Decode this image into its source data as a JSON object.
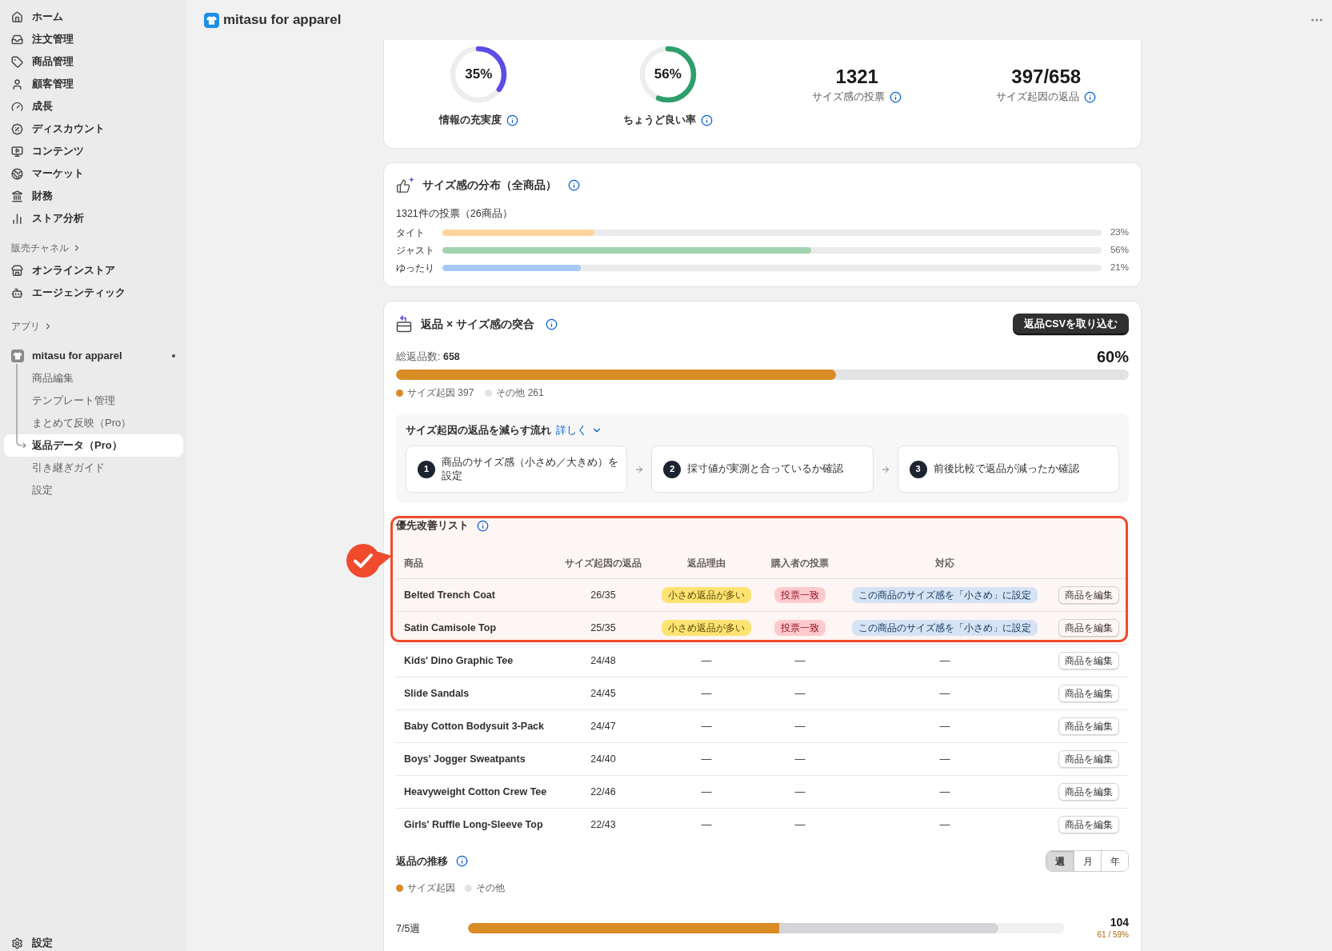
{
  "header": {
    "title": "mitasu for apparel"
  },
  "sidebar": {
    "nav": [
      {
        "label": "ホーム",
        "selected": false
      },
      {
        "label": "注文管理",
        "selected": false
      },
      {
        "label": "商品管理",
        "selected": false
      },
      {
        "label": "顧客管理",
        "selected": false
      },
      {
        "label": "成長",
        "selected": false
      },
      {
        "label": "ディスカウント",
        "selected": false
      },
      {
        "label": "コンテンツ",
        "selected": false
      },
      {
        "label": "マーケット",
        "selected": false
      },
      {
        "label": "財務",
        "selected": false
      },
      {
        "label": "ストア分析",
        "selected": false
      }
    ],
    "sales_channels": {
      "title": "販売チャネル",
      "items": [
        {
          "label": "オンラインストア",
          "selected": false
        },
        {
          "label": "エージェンティック",
          "selected": false
        }
      ]
    },
    "apps": {
      "title": "アプリ",
      "app": {
        "name": "mitasu for apparel",
        "children": [
          {
            "label": "商品編集",
            "selected": false
          },
          {
            "label": "テンプレート管理",
            "selected": false
          },
          {
            "label": "まとめて反映（Pro）",
            "selected": false
          },
          {
            "label": "返品データ（Pro）",
            "selected": true
          },
          {
            "label": "引き継ぎガイド",
            "selected": false
          },
          {
            "label": "設定",
            "selected": false
          }
        ]
      }
    },
    "footer": {
      "label": "設定"
    }
  },
  "stats": [
    {
      "kind": "ring",
      "value": "35%",
      "label": "情報の充実度",
      "level": 0.35,
      "color": "#5b4de6"
    },
    {
      "kind": "ring",
      "value": "56%",
      "label": "ちょうど良い率",
      "level": 0.56,
      "color": "#2e9e6b"
    },
    {
      "kind": "number",
      "value": "1321",
      "label": "サイズ感の投票"
    },
    {
      "kind": "number",
      "value": "397/658",
      "label": "サイズ起因の返品"
    }
  ],
  "distribution": {
    "title": "サイズ感の分布（全商品）",
    "summary": "1321件の投票（26商品）",
    "bars": [
      {
        "label": "タイト",
        "level": 0.23,
        "reading": "23%",
        "color": "#fcd49b"
      },
      {
        "label": "ジャスト",
        "level": 0.56,
        "reading": "56%",
        "color": "#a3d4b2"
      },
      {
        "label": "ゆったり",
        "level": 0.21,
        "reading": "21%",
        "color": "#a5c8f7"
      }
    ]
  },
  "returns": {
    "title": "返品 × サイズ感の突合",
    "import_button": "返品CSVを取り込む",
    "total": "総返品数: **658**",
    "share": "60%",
    "level": 0.6,
    "legend": [
      {
        "label": "サイズ起因 397",
        "color": "#d98b24"
      },
      {
        "label": "その他 261",
        "color": "#e3e3e3"
      }
    ],
    "flow": {
      "title": "サイズ起因の返品を減らす流れ",
      "link": "詳しく",
      "steps": [
        {
          "number": "1",
          "text": "商品のサイズ感（小さめ／大きめ）を設定"
        },
        {
          "number": "2",
          "text": "採寸値が実測と合っているか確認"
        },
        {
          "number": "3",
          "text": "前後比較で返品が減ったか確認"
        }
      ]
    },
    "priority_list": {
      "title": "優先改善リスト",
      "columns": [
        "商品",
        "サイズ起因の返品",
        "返品理由",
        "購入者の投票",
        "対応"
      ],
      "rows": [
        {
          "product": "Belted Trench Coat",
          "returns": "26/35",
          "reason": {
            "kind": "badge",
            "text": "小さめ返品が多い"
          },
          "vote": {
            "kind": "badge",
            "text": "投票一致"
          },
          "action": {
            "kind": "badge",
            "text": "この商品のサイズ感を「小さめ」に設定"
          },
          "button": "商品を編集"
        },
        {
          "product": "Satin Camisole Top",
          "returns": "25/35",
          "reason": {
            "kind": "badge",
            "text": "小さめ返品が多い"
          },
          "vote": {
            "kind": "badge",
            "text": "投票一致"
          },
          "action": {
            "kind": "badge",
            "text": "この商品のサイズ感を「小さめ」に設定"
          },
          "button": "商品を編集"
        },
        {
          "product": "Kids' Dino Graphic Tee",
          "returns": "24/48",
          "reason": {
            "kind": "dash",
            "text": "—"
          },
          "vote": {
            "kind": "dash",
            "text": "—"
          },
          "action": {
            "kind": "dash",
            "text": "—"
          },
          "button": "商品を編集"
        },
        {
          "product": "Slide Sandals",
          "returns": "24/45",
          "reason": {
            "kind": "dash",
            "text": "—"
          },
          "vote": {
            "kind": "dash",
            "text": "—"
          },
          "action": {
            "kind": "dash",
            "text": "—"
          },
          "button": "商品を編集"
        },
        {
          "product": "Baby Cotton Bodysuit 3-Pack",
          "returns": "24/47",
          "reason": {
            "kind": "dash",
            "text": "—"
          },
          "vote": {
            "kind": "dash",
            "text": "—"
          },
          "action": {
            "kind": "dash",
            "text": "—"
          },
          "button": "商品を編集"
        },
        {
          "product": "Boys' Jogger Sweatpants",
          "returns": "24/40",
          "reason": {
            "kind": "dash",
            "text": "—"
          },
          "vote": {
            "kind": "dash",
            "text": "—"
          },
          "action": {
            "kind": "dash",
            "text": "—"
          },
          "button": "商品を編集"
        },
        {
          "product": "Heavyweight Cotton Crew Tee",
          "returns": "22/46",
          "reason": {
            "kind": "dash",
            "text": "—"
          },
          "vote": {
            "kind": "dash",
            "text": "—"
          },
          "action": {
            "kind": "dash",
            "text": "—"
          },
          "button": "商品を編集"
        },
        {
          "product": "Girls' Ruffle Long-Sleeve Top",
          "returns": "22/43",
          "reason": {
            "kind": "dash",
            "text": "—"
          },
          "vote": {
            "kind": "dash",
            "text": "—"
          },
          "action": {
            "kind": "dash",
            "text": "—"
          },
          "button": "商品を編集"
        }
      ]
    },
    "trend": {
      "title": "返品の推移",
      "periods": [
        {
          "label": "週",
          "selected": true
        },
        {
          "label": "月",
          "selected": false
        },
        {
          "label": "年",
          "selected": false
        }
      ],
      "legend": [
        {
          "label": "サイズ起因",
          "color": "#d98b24"
        },
        {
          "label": "その他",
          "color": "#e3e3e3"
        }
      ],
      "weeks": [
        {
          "label": "7/5週",
          "total": "104",
          "detail": "61 / 59%",
          "total_bar": {
            "level": 0.889,
            "color": "#d4d5d9"
          },
          "size_bar": {
            "level": 0.521,
            "color": "#d98b24"
          }
        }
      ]
    }
  }
}
